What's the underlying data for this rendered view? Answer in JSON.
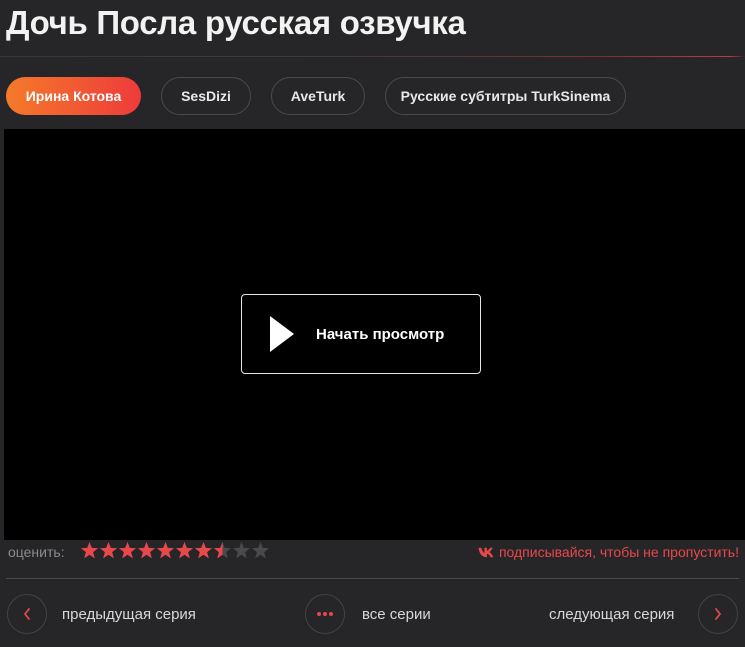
{
  "page": {
    "title": "Дочь Посла русская озвучка"
  },
  "tabs": [
    {
      "label": "Ирина Котова",
      "active": true
    },
    {
      "label": "SesDizi",
      "active": false
    },
    {
      "label": "AveTurk",
      "active": false
    },
    {
      "label": "Русские субтитры TurkSinema",
      "active": false
    }
  ],
  "player": {
    "play_label": "Начать просмотр"
  },
  "rating": {
    "label": "оценить:",
    "stars_total": 10,
    "stars_filled": 7.5,
    "star_color": "#e8474b",
    "star_empty_color": "#4a4a4c"
  },
  "vk": {
    "text": "подписывайся, чтобы не пропустить!",
    "icon": "vk-icon"
  },
  "nav": {
    "prev_label": "предыдущая серия",
    "all_label": "все серии",
    "next_label": "следующая серия"
  },
  "colors": {
    "accent": "#e8474b",
    "tab_gradient_start": "#f47a2a",
    "tab_gradient_end": "#ee3b3b",
    "background": "#262628"
  }
}
